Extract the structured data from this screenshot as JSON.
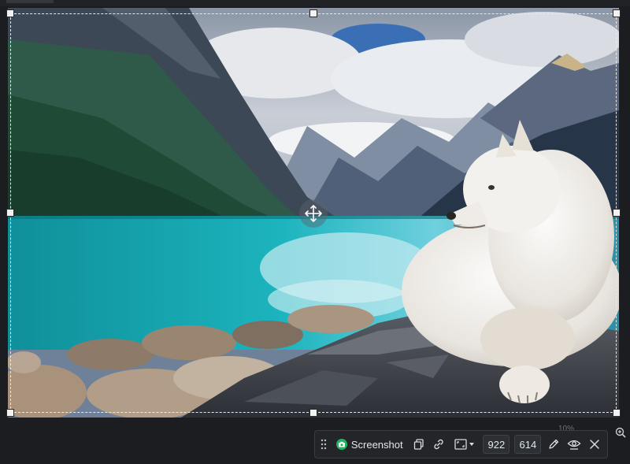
{
  "toolbar": {
    "mode_label": "Screenshot",
    "width_value": "922",
    "height_value": "614"
  },
  "status": {
    "zoom": "10%"
  },
  "icons": {
    "grip": "drag-grip-icon",
    "camera": "camera-icon",
    "copy": "copy-icon",
    "link": "link-icon",
    "aspect": "aspect-ratio-icon",
    "pen": "pen-icon",
    "eye": "preview-icon",
    "close": "close-icon",
    "move": "move-icon",
    "zoom": "zoom-in-icon"
  },
  "colors": {
    "accent": "#1fb55f",
    "toolbar_bg": "#232529",
    "lake": "#1aa7b0"
  }
}
